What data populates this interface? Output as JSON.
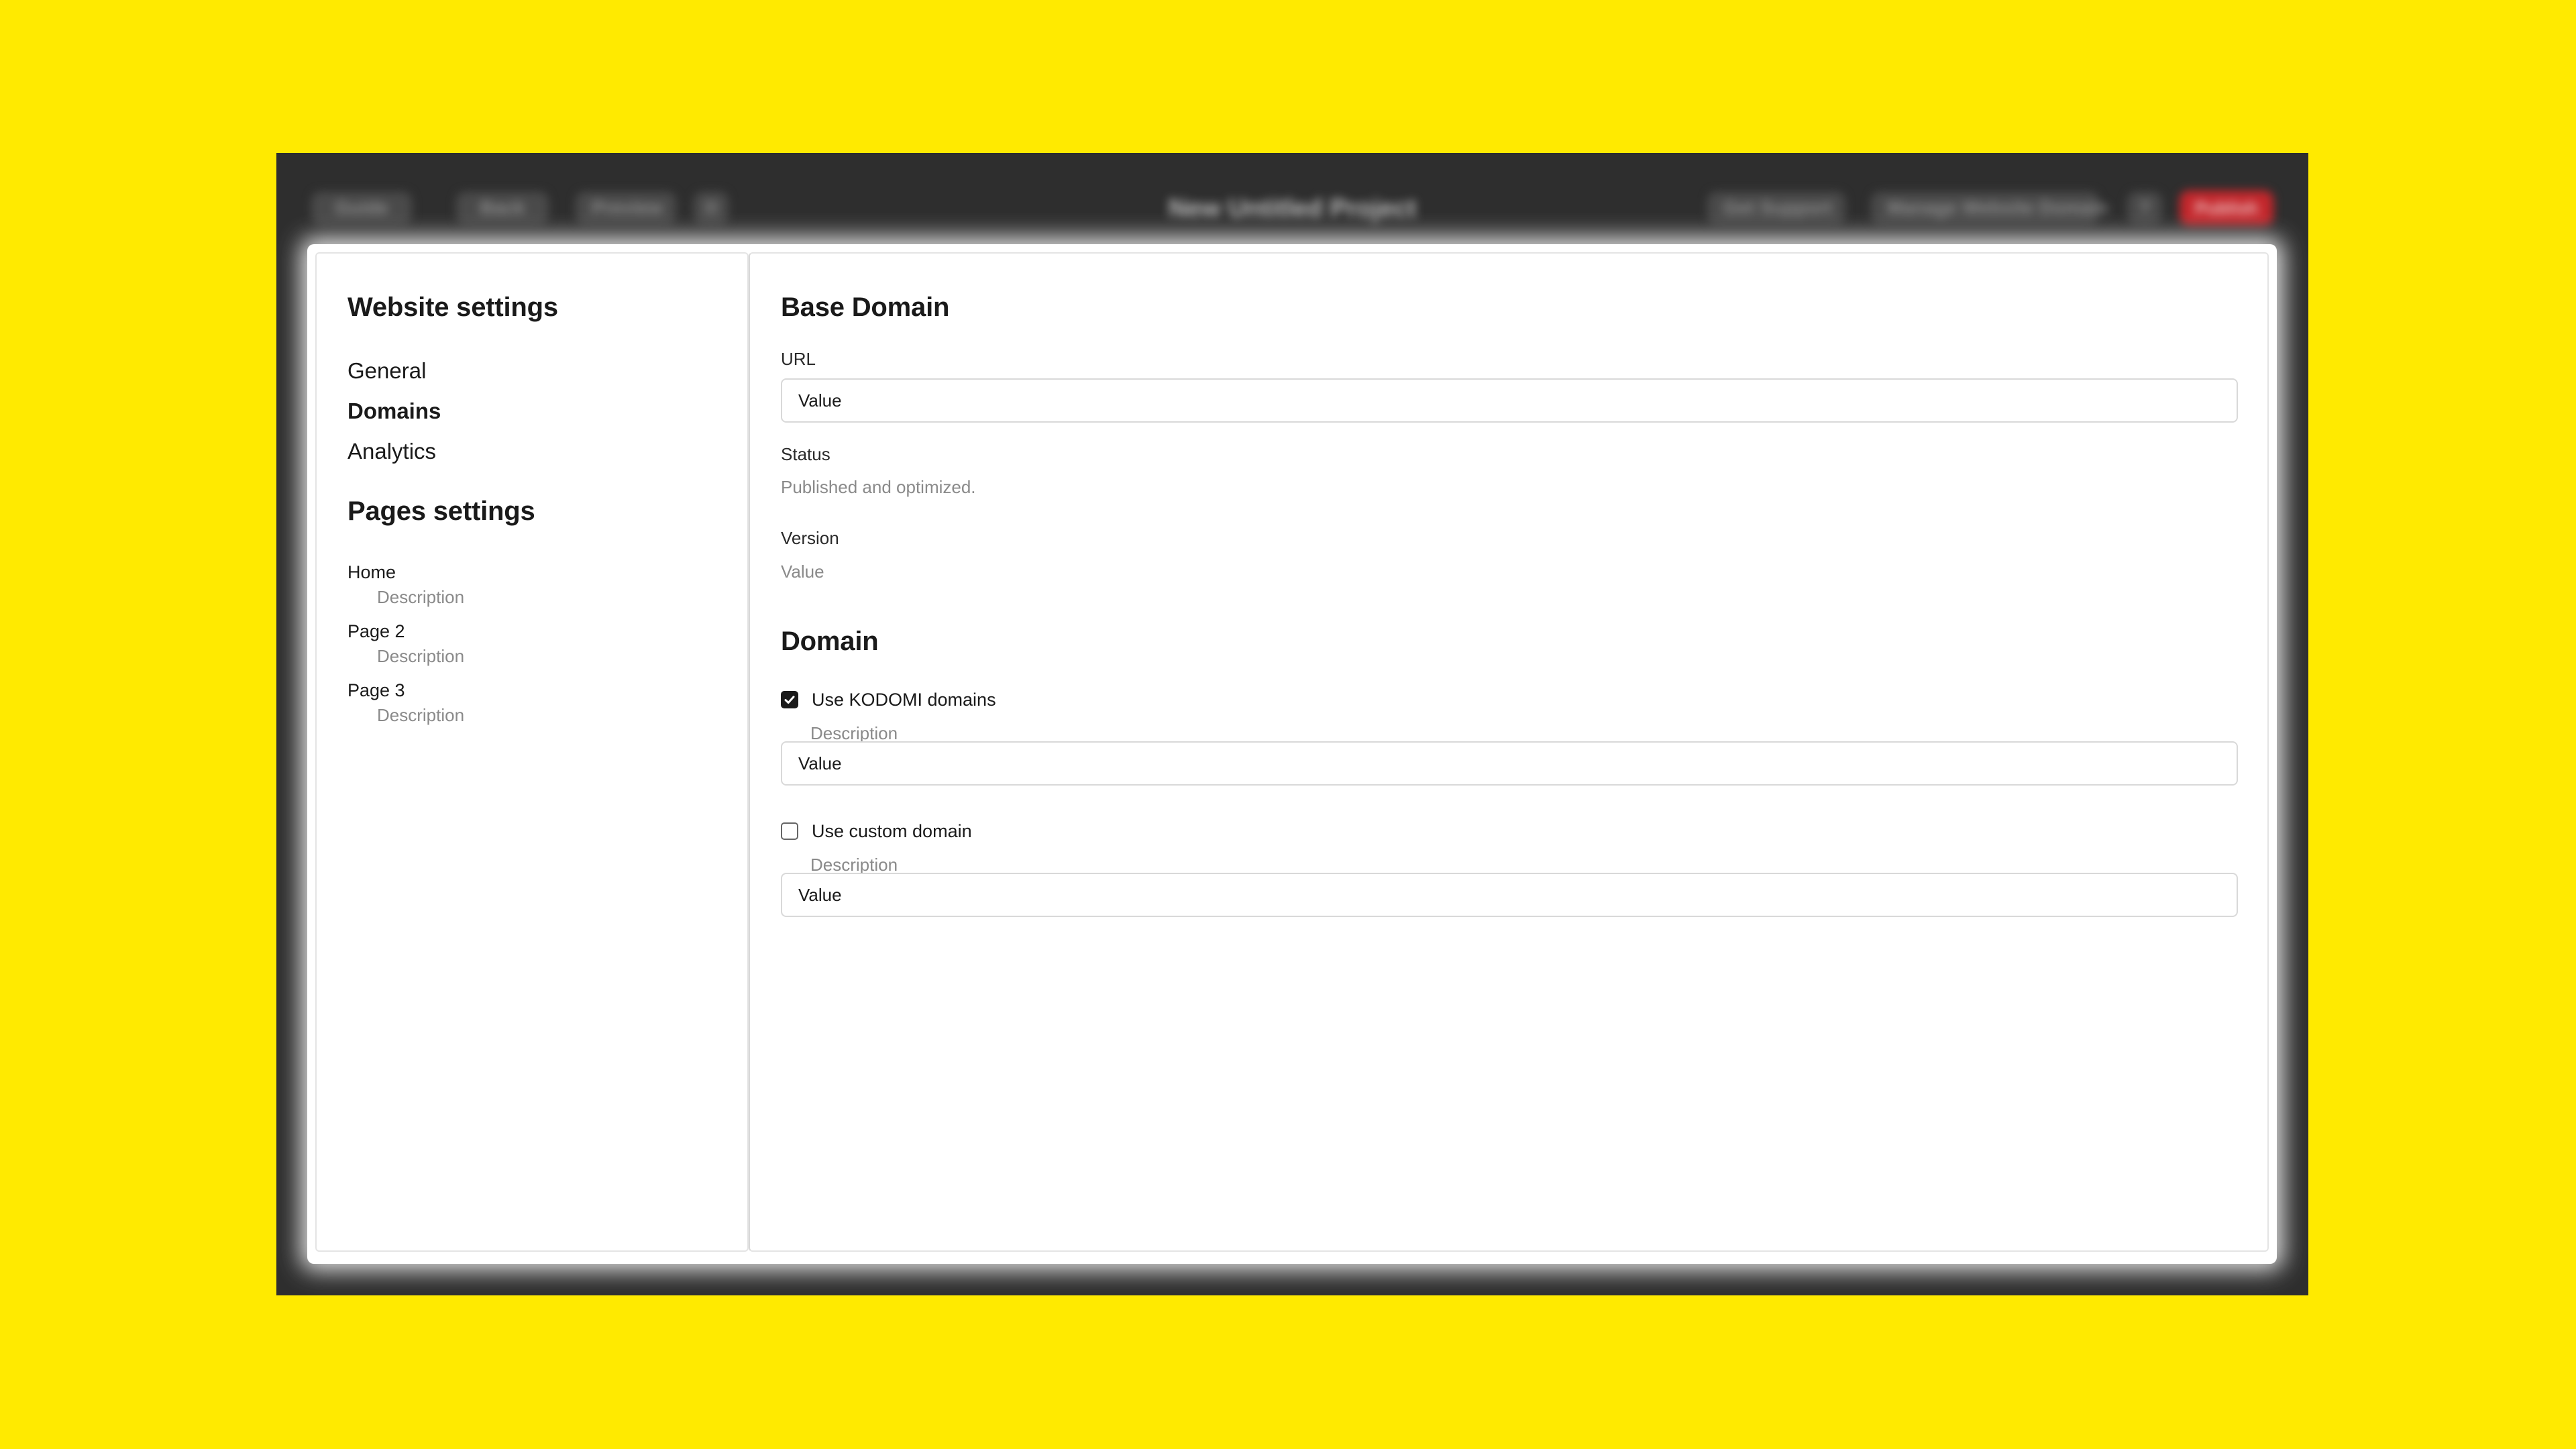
{
  "topbar": {
    "left_pills": [
      "Guide",
      "Back",
      "Preview"
    ],
    "title": "New Untitled Project",
    "right_pills": [
      "Get Support",
      "Manage Website Domain"
    ],
    "cta_label": "Publish"
  },
  "sidebar": {
    "website_heading": "Website settings",
    "website_items": [
      {
        "label": "General",
        "active": false
      },
      {
        "label": "Domains",
        "active": true
      },
      {
        "label": "Analytics",
        "active": false
      }
    ],
    "pages_heading": "Pages settings",
    "pages": [
      {
        "title": "Home",
        "description": "Description"
      },
      {
        "title": "Page 2",
        "description": "Description"
      },
      {
        "title": "Page 3",
        "description": "Description"
      }
    ]
  },
  "main": {
    "base_domain": {
      "heading": "Base Domain",
      "url_label": "URL",
      "url_value": "Value",
      "status_label": "Status",
      "status_value": "Published and optimized.",
      "version_label": "Version",
      "version_value": "Value"
    },
    "domain": {
      "heading": "Domain",
      "kodomi": {
        "label": "Use KODOMI domains",
        "description": "Description",
        "checked": true,
        "value": "Value"
      },
      "custom": {
        "label": "Use custom domain",
        "description": "Description",
        "checked": false,
        "value": "Value"
      }
    }
  },
  "colors": {
    "backdrop": "#FFEA00",
    "window": "#2E2E2E",
    "cta": "#C4272C"
  }
}
